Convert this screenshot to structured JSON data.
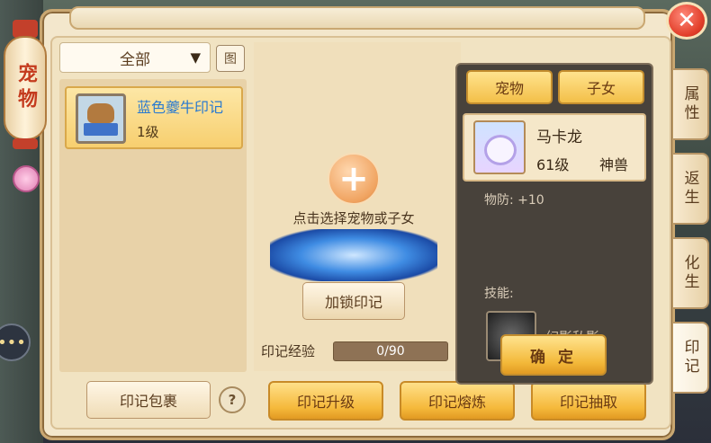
{
  "title_lantern": "宠物",
  "filter": {
    "selected": "全部",
    "icon": "filter-icon",
    "icon_glyph": "图"
  },
  "list": [
    {
      "name": "蓝色夔牛印记",
      "level": "1级"
    }
  ],
  "center": {
    "hint": "点击选择宠物或子女",
    "lock_label": "加锁印记",
    "exp_label": "印记经验",
    "exp_text": "0/90",
    "exp_value": 0,
    "exp_max": 90
  },
  "bottom": {
    "bag_label": "印记包裹",
    "help_glyph": "?",
    "upgrade_label": "印记升级",
    "refine_label": "印记熔炼",
    "extract_label": "印记抽取"
  },
  "tabs": [
    "属性",
    "返生",
    "化生",
    "印记"
  ],
  "active_tab": "印记",
  "popup": {
    "seg_pet": "宠物",
    "seg_child": "子女",
    "pet": {
      "name": "马卡龙",
      "level": "61级",
      "type": "神兽"
    },
    "stat": "物防: +10",
    "skills_label": "技能:",
    "skill_name": "幻影私影",
    "confirm_label": "确 定"
  },
  "close_glyph": "✕",
  "chat_glyph": "•••"
}
